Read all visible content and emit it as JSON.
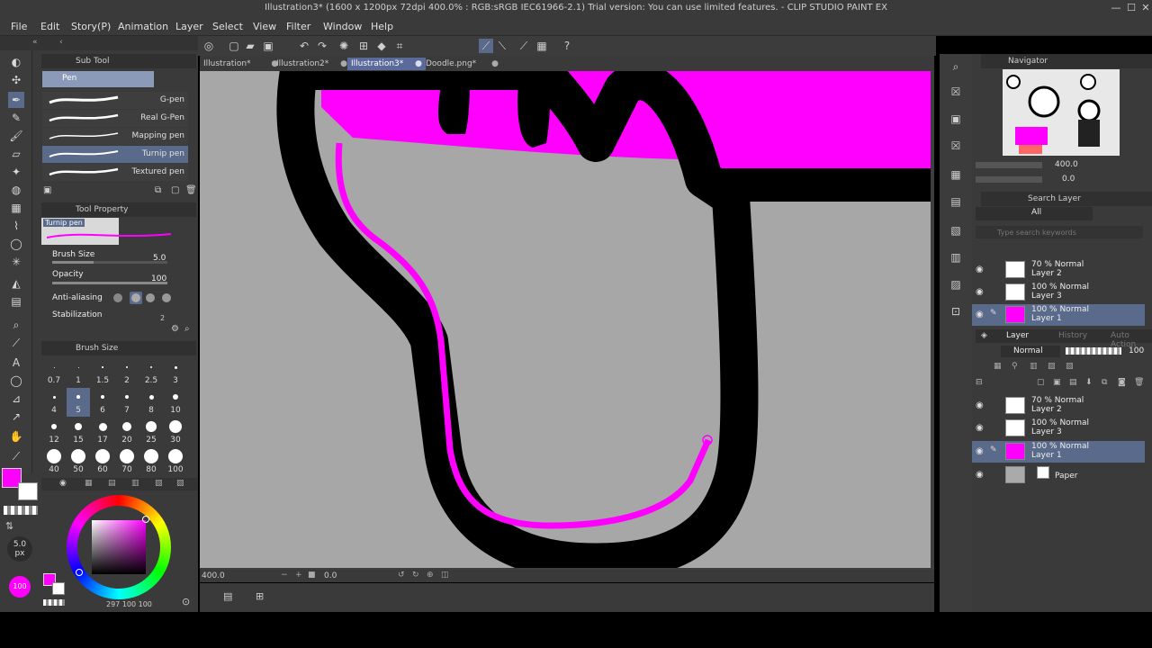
{
  "window": {
    "title": "Illustration3* (1600 x 1200px 72dpi 400.0% : RGB:sRGB IEC61966-2.1) Trial version: You can use limited features. - CLIP STUDIO PAINT EX",
    "minimize": "—",
    "maximize": "☐",
    "close": "✕"
  },
  "menu": [
    "File",
    "Edit",
    "Story(P)",
    "Animation",
    "Layer",
    "Select",
    "View",
    "Filter",
    "Window",
    "Help"
  ],
  "subtool": {
    "panel_title": "Sub Tool",
    "group": "Pen",
    "brushes": [
      "G-pen",
      "Real G-Pen",
      "Mapping pen",
      "Turnip pen",
      "Textured pen"
    ],
    "selected_index": 3
  },
  "tool_property": {
    "panel_title": "Tool Property",
    "preview_label": "Turnip pen",
    "brush_size_label": "Brush Size",
    "brush_size_value": "5.0",
    "opacity_label": "Opacity",
    "opacity_value": "100",
    "antialiasing_label": "Anti-aliasing",
    "stabilization_label": "Stabilization",
    "stabilization_value": "2"
  },
  "brush_size_panel": {
    "title": "Brush Size",
    "sizes": [
      "0.7",
      "1",
      "1.5",
      "2",
      "2.5",
      "3",
      "4",
      "5",
      "6",
      "7",
      "8",
      "10",
      "12",
      "15",
      "17",
      "20",
      "25",
      "30",
      "40",
      "50",
      "60",
      "70",
      "80",
      "100"
    ],
    "selected": "5"
  },
  "colors": {
    "main": "#ff00ff",
    "sub": "#ffffff",
    "accent": "#5a6a8a"
  },
  "size_indicator": {
    "value": "5.0",
    "unit": "px"
  },
  "opacity_indicator": "100",
  "color_values": "297 100 100",
  "tabs": [
    {
      "label": "Illustration*",
      "active": false
    },
    {
      "label": "Illustration2*",
      "active": false
    },
    {
      "label": "Illustration3*",
      "active": true
    },
    {
      "label": "Doodle.png*",
      "active": false
    }
  ],
  "status": {
    "zoom": "400.0",
    "angle": "0.0"
  },
  "navigator": {
    "title": "Navigator",
    "zoom": "400.0",
    "angle": "0.0"
  },
  "search_layer": {
    "title": "Search Layer",
    "filter": "All",
    "placeholder": "Type search keywords"
  },
  "search_results": [
    {
      "line1": "70 % Normal",
      "line2": "Layer 2",
      "selected": false
    },
    {
      "line1": "100 % Normal",
      "line2": "Layer 3",
      "selected": false
    },
    {
      "line1": "100 % Normal",
      "line2": "Layer 1",
      "selected": true
    }
  ],
  "layer_panel": {
    "tabs": [
      "Layer",
      "History",
      "Auto Action"
    ],
    "blend_mode": "Normal",
    "opacity": "100",
    "layers": [
      {
        "line1": "70 % Normal",
        "line2": "Layer 2",
        "selected": false
      },
      {
        "line1": "100 % Normal",
        "line2": "Layer 3",
        "selected": false
      },
      {
        "line1": "100 % Normal",
        "line2": "Layer 1",
        "selected": true
      }
    ],
    "paper_label": "Paper"
  }
}
